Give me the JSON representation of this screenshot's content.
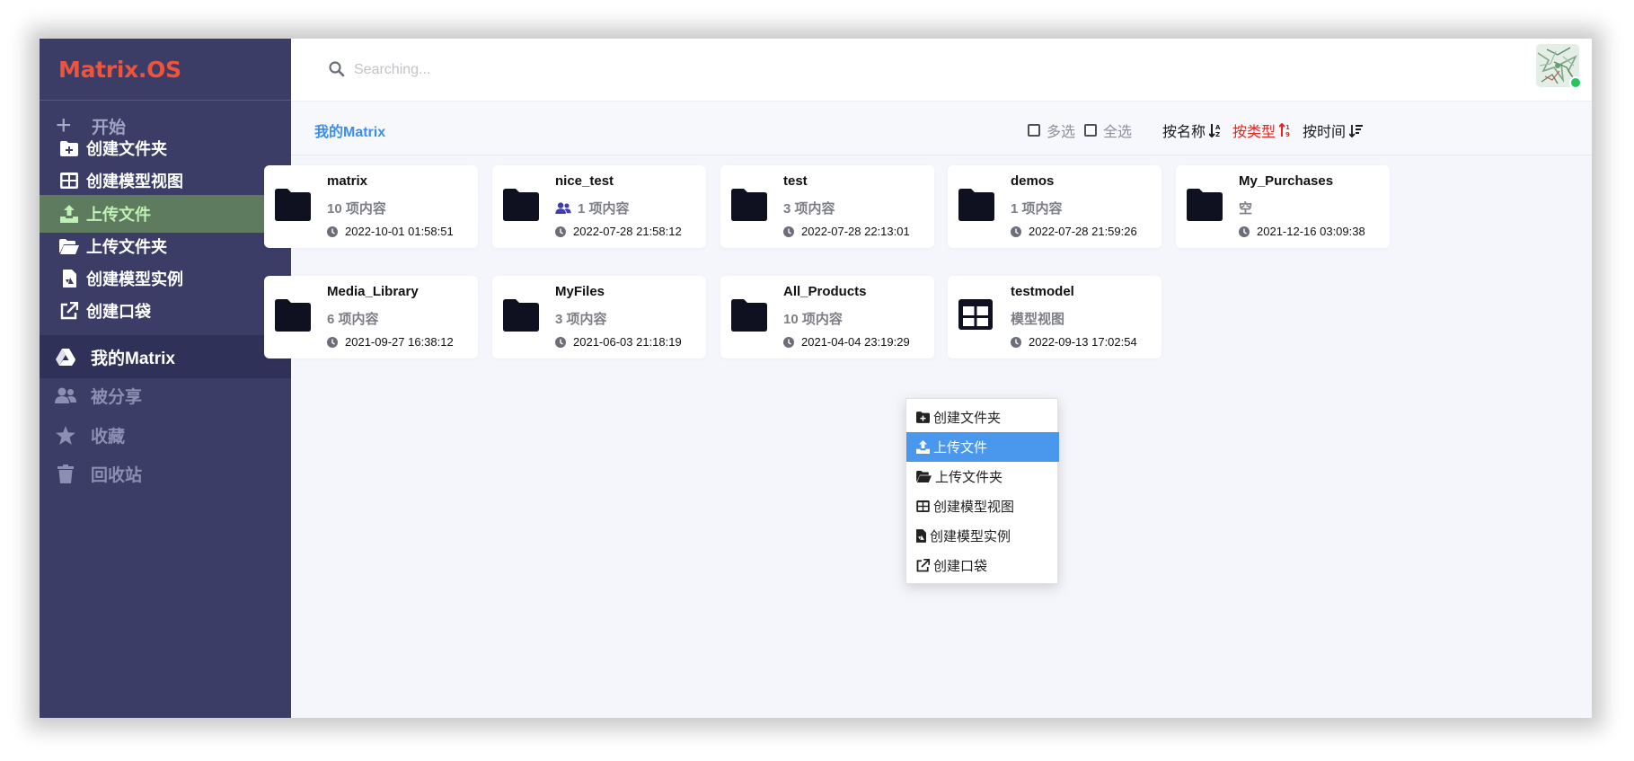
{
  "app": {
    "logo": "Matrix.OS"
  },
  "sidebar": {
    "start_label": "开始",
    "actions": [
      {
        "label": "创建文件夹",
        "icon": "folder-plus-icon"
      },
      {
        "label": "创建模型视图",
        "icon": "table-icon"
      },
      {
        "label": "上传文件",
        "icon": "upload-icon",
        "active": true
      },
      {
        "label": "上传文件夹",
        "icon": "folder-open-icon"
      },
      {
        "label": "创建模型实例",
        "icon": "file-icon"
      },
      {
        "label": "创建口袋",
        "icon": "external-link-icon"
      }
    ],
    "nav": [
      {
        "label": "我的Matrix",
        "icon": "drive-icon",
        "active": true
      },
      {
        "label": "被分享",
        "icon": "users-icon"
      },
      {
        "label": "收藏",
        "icon": "star-icon"
      },
      {
        "label": "回收站",
        "icon": "trash-icon"
      }
    ]
  },
  "search": {
    "placeholder": "Searching..."
  },
  "toolbar": {
    "breadcrumb": "我的Matrix",
    "multi_select": "多选",
    "select_all": "全选",
    "sort_name": "按名称",
    "sort_type": "按类型",
    "sort_time": "按时间",
    "accent": "#e8241b"
  },
  "items": [
    {
      "name": "matrix",
      "count": "10 项内容",
      "time": "2022-10-01 01:58:51",
      "icon": "folder-icon"
    },
    {
      "name": "nice_test",
      "count": "1 项内容",
      "time": "2022-07-28 21:58:12",
      "icon": "folder-icon",
      "shared": true
    },
    {
      "name": "test",
      "count": "3 项内容",
      "time": "2022-07-28 22:13:01",
      "icon": "folder-icon"
    },
    {
      "name": "demos",
      "count": "1 项内容",
      "time": "2022-07-28 21:59:26",
      "icon": "folder-icon"
    },
    {
      "name": "My_Purchases",
      "count": "空",
      "time": "2021-12-16 03:09:38",
      "icon": "folder-icon"
    },
    {
      "name": "Media_Library",
      "count": "6 项内容",
      "time": "2021-09-27 16:38:12",
      "icon": "folder-icon"
    },
    {
      "name": "MyFiles",
      "count": "3 项内容",
      "time": "2021-06-03 21:18:19",
      "icon": "folder-icon"
    },
    {
      "name": "All_Products",
      "count": "10 项内容",
      "time": "2021-04-04 23:19:29",
      "icon": "folder-icon"
    },
    {
      "name": "testmodel",
      "count": "模型视图",
      "time": "2022-09-13 17:02:54",
      "icon": "table-icon"
    }
  ],
  "context_menu": [
    {
      "label": "创建文件夹",
      "icon": "folder-plus-icon"
    },
    {
      "label": "上传文件",
      "icon": "upload-icon",
      "active": true
    },
    {
      "label": "上传文件夹",
      "icon": "folder-open-icon"
    },
    {
      "label": "创建模型视图",
      "icon": "table-icon"
    },
    {
      "label": "创建模型实例",
      "icon": "file-icon"
    },
    {
      "label": "创建口袋",
      "icon": "external-link-icon"
    }
  ]
}
